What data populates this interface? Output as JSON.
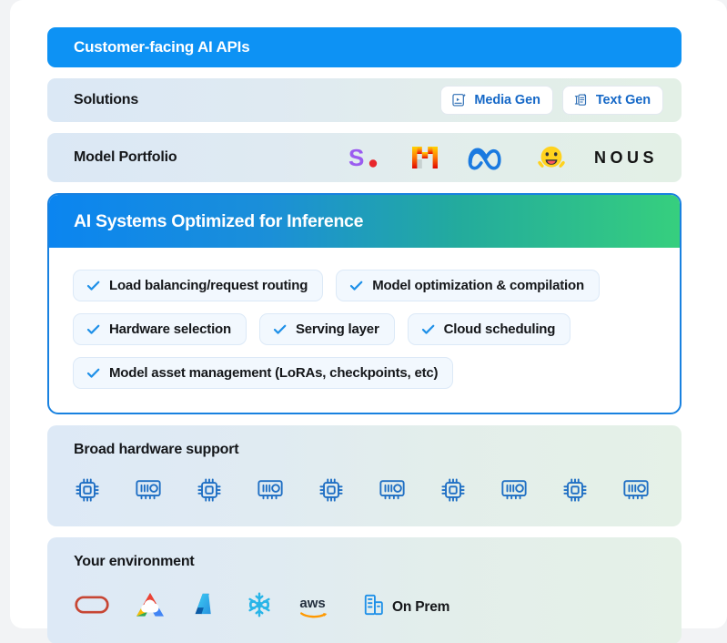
{
  "api_bar": {
    "label": "Customer-facing AI APIs"
  },
  "solutions": {
    "label": "Solutions",
    "buttons": [
      {
        "label": "Media Gen",
        "icon": "media-gen-icon"
      },
      {
        "label": "Text Gen",
        "icon": "text-gen-icon"
      }
    ]
  },
  "model_portfolio": {
    "label": "Model Portfolio",
    "logos": [
      {
        "name": "stability-ai-logo",
        "text": "S."
      },
      {
        "name": "mistral-ai-logo",
        "text": "M"
      },
      {
        "name": "meta-logo",
        "text": ""
      },
      {
        "name": "hugging-face-logo",
        "text": ""
      },
      {
        "name": "nous-research-logo",
        "text": "NOUS"
      }
    ]
  },
  "inference_panel": {
    "title": "AI Systems Optimized for Inference",
    "rows": [
      [
        "Load balancing/request routing",
        "Model optimization & compilation"
      ],
      [
        "Hardware selection",
        "Serving layer",
        "Cloud scheduling"
      ],
      [
        "Model asset management (LoRAs, checkpoints, etc)"
      ]
    ]
  },
  "hardware": {
    "title": "Broad hardware support",
    "icons": [
      "cpu-chip-icon",
      "gpu-card-icon",
      "cpu-chip-icon",
      "gpu-card-icon",
      "cpu-chip-icon",
      "gpu-card-icon",
      "cpu-chip-icon",
      "gpu-card-icon",
      "cpu-chip-icon",
      "gpu-card-icon"
    ]
  },
  "environment": {
    "title": "Your environment",
    "providers": [
      {
        "name": "oracle-cloud-logo",
        "label": ""
      },
      {
        "name": "google-cloud-logo",
        "label": ""
      },
      {
        "name": "microsoft-azure-logo",
        "label": ""
      },
      {
        "name": "snowflake-logo",
        "label": ""
      },
      {
        "name": "aws-logo",
        "label": "aws"
      },
      {
        "name": "on-prem-icon",
        "label": "On Prem"
      }
    ]
  },
  "colors": {
    "api_blue": "#0d92f4",
    "panel_border": "#1881e0",
    "gradient_start": "#0b85f0",
    "gradient_end": "#36cf7e",
    "check_blue": "#1e90e8",
    "link_blue": "#1568c7"
  }
}
